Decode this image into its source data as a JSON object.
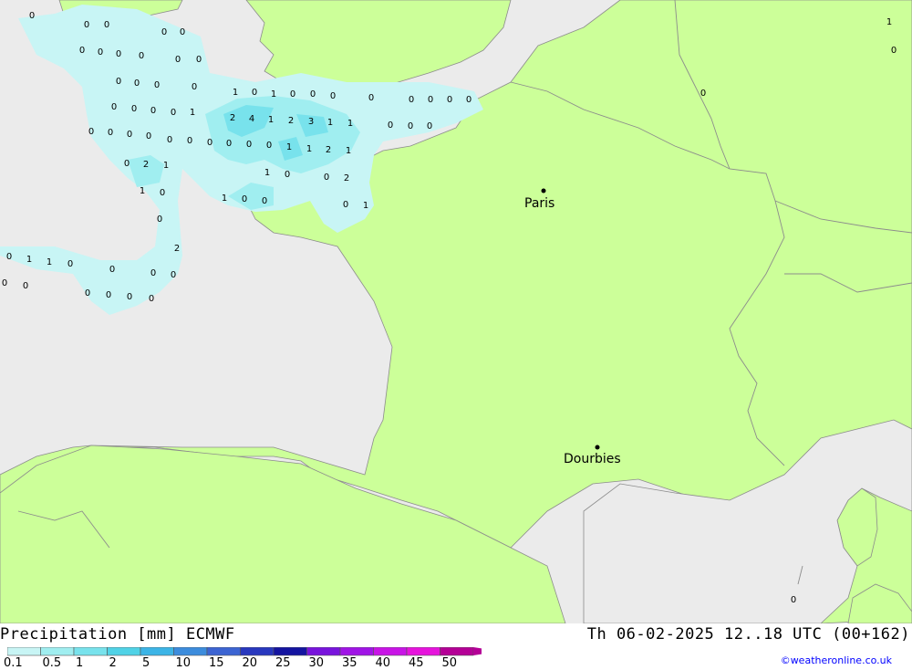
{
  "title": {
    "left": "Precipitation [mm] ECMWF",
    "right": "Th 06-02-2025 12..18 UTC (00+162)"
  },
  "credit": "©weatheronline.co.uk",
  "legend": {
    "labels": [
      "0.1",
      "0.5",
      "1",
      "2",
      "5",
      "10",
      "15",
      "20",
      "25",
      "30",
      "35",
      "40",
      "45",
      "50"
    ],
    "colors": [
      "#c8f5f5",
      "#a0eef0",
      "#78e2ec",
      "#50d2e6",
      "#3cb4e6",
      "#3c8cdc",
      "#3c64d2",
      "#2838be",
      "#1414a0",
      "#7814dc",
      "#a014e6",
      "#c814e6",
      "#e614dc",
      "#b40096"
    ]
  },
  "cities": [
    {
      "name": "Paris"
    },
    {
      "name": "Dourbies"
    }
  ],
  "values": [
    "0",
    "0",
    "0",
    "0",
    "0",
    "0",
    "0",
    "0",
    "0",
    "0",
    "0",
    "0",
    "0",
    "0",
    "0",
    "0",
    "0",
    "0",
    "0",
    "1",
    "1",
    "0",
    "1",
    "0",
    "0",
    "0",
    "0",
    "0",
    "0",
    "0",
    "0",
    "0",
    "0",
    "0",
    "0",
    "2",
    "4",
    "1",
    "2",
    "3",
    "1",
    "1",
    "0",
    "0",
    "0",
    "0",
    "0",
    "0",
    "0",
    "0",
    "0",
    "1",
    "1",
    "2",
    "1",
    "0",
    "2",
    "1",
    "1",
    "0",
    "0",
    "2",
    "1",
    "0",
    "1",
    "0",
    "0",
    "0",
    "1",
    "0",
    "2",
    "0",
    "1",
    "1",
    "0",
    "0",
    "0",
    "0",
    "0",
    "0",
    "0",
    "0",
    "0",
    "0",
    "0",
    "1",
    "0",
    "0",
    "0",
    "1"
  ],
  "colors": {
    "land": "#ccff99",
    "sea": "#ebebeb",
    "border": "#8c8c8c",
    "precip_light": "#c8f5f5",
    "precip_mid": "#a0eef0",
    "precip_heavy": "#78e2ec"
  }
}
